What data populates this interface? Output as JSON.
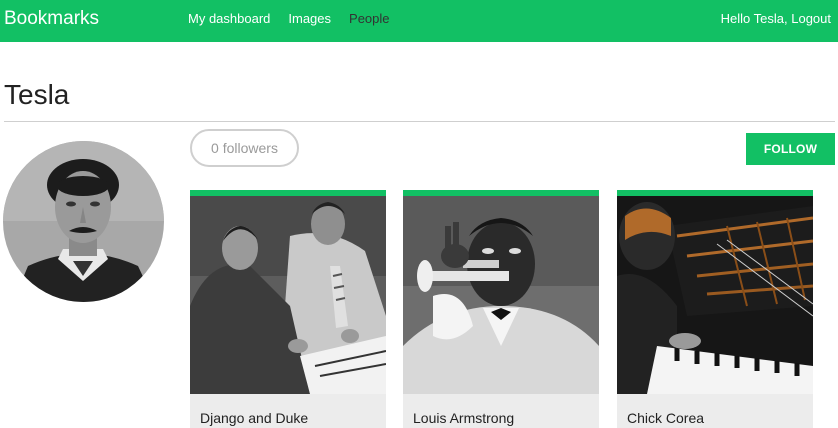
{
  "header": {
    "logo": "Bookmarks",
    "menu": [
      {
        "label": "My dashboard",
        "selected": false
      },
      {
        "label": "Images",
        "selected": false
      },
      {
        "label": "People",
        "selected": true
      }
    ],
    "greeting": "Hello Tesla, ",
    "logout": "Logout"
  },
  "profile": {
    "name": "Tesla",
    "followers_label": "0 followers",
    "follow_label": "FOLLOW"
  },
  "images": [
    {
      "title": "Django and Duke"
    },
    {
      "title": "Louis Armstrong"
    },
    {
      "title": "Chick Corea"
    }
  ],
  "colors": {
    "brand": "#12c064",
    "selected_menu_text": "#333333",
    "card_background": "#ececec"
  },
  "icons": {
    "avatar": "person-photo",
    "thumbnails": "photo"
  }
}
